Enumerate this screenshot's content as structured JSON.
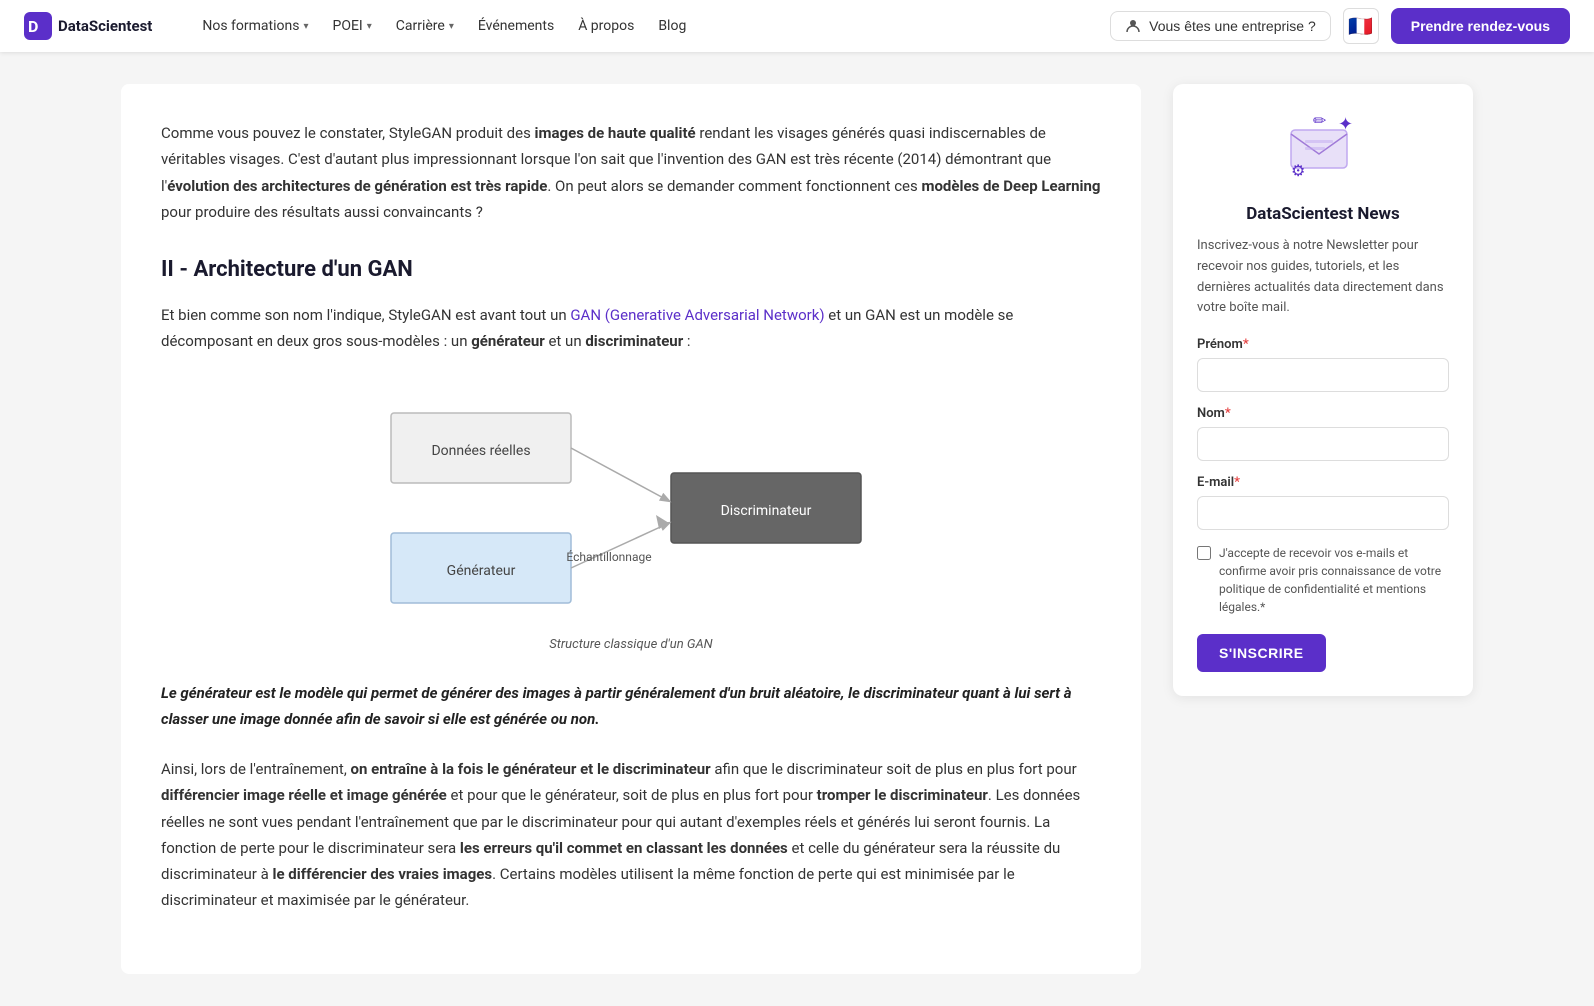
{
  "navbar": {
    "logo_text": "DataScientest",
    "nav_items": [
      {
        "label": "Nos formations",
        "has_dropdown": true
      },
      {
        "label": "POEI",
        "has_dropdown": true
      },
      {
        "label": "Carrière",
        "has_dropdown": true
      },
      {
        "label": "Événements",
        "has_dropdown": false
      },
      {
        "label": "À propos",
        "has_dropdown": false
      },
      {
        "label": "Blog",
        "has_dropdown": false
      }
    ],
    "enterprise_label": "Vous êtes une entreprise ?",
    "flag_emoji": "🇫🇷",
    "cta_label": "Prendre rendez-vous"
  },
  "main": {
    "intro_paragraph": "Comme vous pouvez le constater, StyleGAN produit des ",
    "intro_bold1": "images de haute qualité",
    "intro_rest1": " rendant les visages générés quasi indiscernables de véritables visages. C'est d'autant plus impressionnant lorsque l'on sait que l'invention des GAN est très récente (2014) démontrant que l'",
    "intro_bold2": "évolution des architectures de génération est très rapide",
    "intro_rest2": ". On peut alors se demander comment fonctionnent ces ",
    "intro_bold3": "modèles de Deep Learning",
    "intro_rest3": " pour produire des résultats aussi convaincants ?",
    "section_title": "II - Architecture d'un GAN",
    "body1_pre": "Et bien comme son nom l'indique, StyleGAN est avant tout un ",
    "body1_link": "GAN (Generative Adversarial Network)",
    "body1_post": " et un GAN est un modèle se décomposant en deux gros sous-modèles : un ",
    "body1_bold1": "générateur",
    "body1_mid": " et un ",
    "body1_bold2": "discriminateur",
    "body1_end": " :",
    "diagram_caption": "Structure classique d'un GAN",
    "diagram": {
      "box_donnees_label": "Données réelles",
      "box_generateur_label": "Générateur",
      "box_discriminateur_label": "Discriminateur",
      "arrow_label": "Échantillonnage"
    },
    "blockquote": "Le générateur est le modèle qui permet de générer des images à partir généralement d'un bruit aléatoire, le discriminateur quant à lui sert à classer une image donnée afin de savoir si elle est générée ou non.",
    "body2_pre": "Ainsi, lors de l'entraînement, ",
    "body2_bold1": "on entraîne à la fois le générateur et le discriminateur",
    "body2_rest1": " afin que le discriminateur soit de plus en plus fort pour ",
    "body2_bold2": "différencier image réelle et image générée",
    "body2_rest2": " et pour que le générateur, soit de plus en plus fort pour ",
    "body2_bold3": "tromper le discriminateur",
    "body2_rest3": ". Les données réelles ne sont vues pendant l'entraînement que par le discriminateur pour qui autant d'exemples réels et générés lui seront fournis. La fonction de perte pour le discriminateur sera ",
    "body2_bold4": "les erreurs qu'il commet en classant les données",
    "body2_rest4": " et celle du générateur sera la réussite du discriminateur à ",
    "body2_bold5": "le différencier des vraies images",
    "body2_rest5": ". Certains modèles utilisent la même fonction de perte qui est minimisée par le discriminateur et maximisée par le générateur."
  },
  "sidebar": {
    "newsletter_title": "DataScientest News",
    "newsletter_desc": "Inscrivez-vous à notre Newsletter pour recevoir nos guides, tutoriels, et les dernières actualités data directement dans votre boîte mail.",
    "prenom_label": "Prénom",
    "nom_label": "Nom",
    "email_label": "E-mail",
    "required_marker": "*",
    "checkbox_text": "J'accepte de recevoir vos e-mails et confirme avoir pris connaissance de votre politique de confidentialité et mentions légales.*",
    "subscribe_label": "S'INSCRIRE"
  }
}
